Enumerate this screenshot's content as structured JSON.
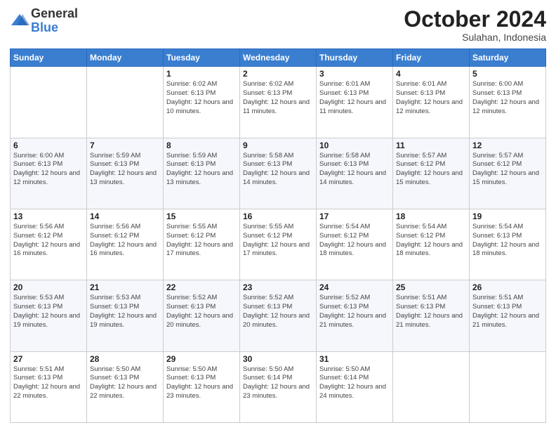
{
  "logo": {
    "general": "General",
    "blue": "Blue"
  },
  "header": {
    "month": "October 2024",
    "location": "Sulahan, Indonesia"
  },
  "days_of_week": [
    "Sunday",
    "Monday",
    "Tuesday",
    "Wednesday",
    "Thursday",
    "Friday",
    "Saturday"
  ],
  "weeks": [
    [
      {
        "day": "",
        "info": ""
      },
      {
        "day": "",
        "info": ""
      },
      {
        "day": "1",
        "info": "Sunrise: 6:02 AM\nSunset: 6:13 PM\nDaylight: 12 hours and 10 minutes."
      },
      {
        "day": "2",
        "info": "Sunrise: 6:02 AM\nSunset: 6:13 PM\nDaylight: 12 hours and 11 minutes."
      },
      {
        "day": "3",
        "info": "Sunrise: 6:01 AM\nSunset: 6:13 PM\nDaylight: 12 hours and 11 minutes."
      },
      {
        "day": "4",
        "info": "Sunrise: 6:01 AM\nSunset: 6:13 PM\nDaylight: 12 hours and 12 minutes."
      },
      {
        "day": "5",
        "info": "Sunrise: 6:00 AM\nSunset: 6:13 PM\nDaylight: 12 hours and 12 minutes."
      }
    ],
    [
      {
        "day": "6",
        "info": "Sunrise: 6:00 AM\nSunset: 6:13 PM\nDaylight: 12 hours and 12 minutes."
      },
      {
        "day": "7",
        "info": "Sunrise: 5:59 AM\nSunset: 6:13 PM\nDaylight: 12 hours and 13 minutes."
      },
      {
        "day": "8",
        "info": "Sunrise: 5:59 AM\nSunset: 6:13 PM\nDaylight: 12 hours and 13 minutes."
      },
      {
        "day": "9",
        "info": "Sunrise: 5:58 AM\nSunset: 6:13 PM\nDaylight: 12 hours and 14 minutes."
      },
      {
        "day": "10",
        "info": "Sunrise: 5:58 AM\nSunset: 6:13 PM\nDaylight: 12 hours and 14 minutes."
      },
      {
        "day": "11",
        "info": "Sunrise: 5:57 AM\nSunset: 6:12 PM\nDaylight: 12 hours and 15 minutes."
      },
      {
        "day": "12",
        "info": "Sunrise: 5:57 AM\nSunset: 6:12 PM\nDaylight: 12 hours and 15 minutes."
      }
    ],
    [
      {
        "day": "13",
        "info": "Sunrise: 5:56 AM\nSunset: 6:12 PM\nDaylight: 12 hours and 16 minutes."
      },
      {
        "day": "14",
        "info": "Sunrise: 5:56 AM\nSunset: 6:12 PM\nDaylight: 12 hours and 16 minutes."
      },
      {
        "day": "15",
        "info": "Sunrise: 5:55 AM\nSunset: 6:12 PM\nDaylight: 12 hours and 17 minutes."
      },
      {
        "day": "16",
        "info": "Sunrise: 5:55 AM\nSunset: 6:12 PM\nDaylight: 12 hours and 17 minutes."
      },
      {
        "day": "17",
        "info": "Sunrise: 5:54 AM\nSunset: 6:12 PM\nDaylight: 12 hours and 18 minutes."
      },
      {
        "day": "18",
        "info": "Sunrise: 5:54 AM\nSunset: 6:12 PM\nDaylight: 12 hours and 18 minutes."
      },
      {
        "day": "19",
        "info": "Sunrise: 5:54 AM\nSunset: 6:13 PM\nDaylight: 12 hours and 18 minutes."
      }
    ],
    [
      {
        "day": "20",
        "info": "Sunrise: 5:53 AM\nSunset: 6:13 PM\nDaylight: 12 hours and 19 minutes."
      },
      {
        "day": "21",
        "info": "Sunrise: 5:53 AM\nSunset: 6:13 PM\nDaylight: 12 hours and 19 minutes."
      },
      {
        "day": "22",
        "info": "Sunrise: 5:52 AM\nSunset: 6:13 PM\nDaylight: 12 hours and 20 minutes."
      },
      {
        "day": "23",
        "info": "Sunrise: 5:52 AM\nSunset: 6:13 PM\nDaylight: 12 hours and 20 minutes."
      },
      {
        "day": "24",
        "info": "Sunrise: 5:52 AM\nSunset: 6:13 PM\nDaylight: 12 hours and 21 minutes."
      },
      {
        "day": "25",
        "info": "Sunrise: 5:51 AM\nSunset: 6:13 PM\nDaylight: 12 hours and 21 minutes."
      },
      {
        "day": "26",
        "info": "Sunrise: 5:51 AM\nSunset: 6:13 PM\nDaylight: 12 hours and 21 minutes."
      }
    ],
    [
      {
        "day": "27",
        "info": "Sunrise: 5:51 AM\nSunset: 6:13 PM\nDaylight: 12 hours and 22 minutes."
      },
      {
        "day": "28",
        "info": "Sunrise: 5:50 AM\nSunset: 6:13 PM\nDaylight: 12 hours and 22 minutes."
      },
      {
        "day": "29",
        "info": "Sunrise: 5:50 AM\nSunset: 6:13 PM\nDaylight: 12 hours and 23 minutes."
      },
      {
        "day": "30",
        "info": "Sunrise: 5:50 AM\nSunset: 6:14 PM\nDaylight: 12 hours and 23 minutes."
      },
      {
        "day": "31",
        "info": "Sunrise: 5:50 AM\nSunset: 6:14 PM\nDaylight: 12 hours and 24 minutes."
      },
      {
        "day": "",
        "info": ""
      },
      {
        "day": "",
        "info": ""
      }
    ]
  ]
}
